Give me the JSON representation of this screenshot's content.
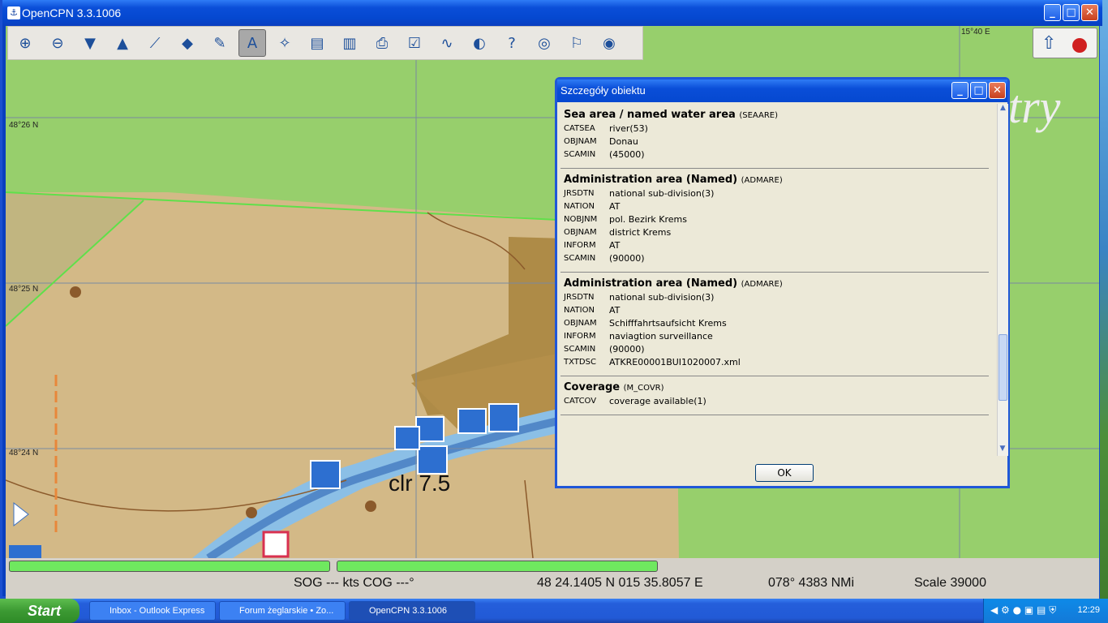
{
  "window": {
    "title": "OpenCPN 3.3.1006"
  },
  "chart": {
    "lat_labels": [
      "48°26 N",
      "48°25 N",
      "48°24 N"
    ],
    "lon_label": "15°40 E",
    "map_text": "clr 7.5",
    "overlay_text": "try"
  },
  "status": {
    "sog": "SOG --- kts COG ---°",
    "position": "48 24.1405 N   015 35.8057 E",
    "bearing": "078°  4383 NMi",
    "scale": "Scale 39000"
  },
  "dialog": {
    "title": "Szczegóły obiektu",
    "ok_label": "OK",
    "sections": [
      {
        "title": "Sea area / named water area",
        "code": "(SEAARE)",
        "rows": [
          [
            "CATSEA",
            "river(53)"
          ],
          [
            "OBJNAM",
            "Donau"
          ],
          [
            "SCAMIN",
            "(45000)"
          ]
        ]
      },
      {
        "title": "Administration area (Named)",
        "code": "(ADMARE)",
        "rows": [
          [
            "JRSDTN",
            "national sub-division(3)"
          ],
          [
            "NATION",
            "AT"
          ],
          [
            "NOBJNM",
            "pol. Bezirk Krems"
          ],
          [
            "OBJNAM",
            "district Krems"
          ],
          [
            "INFORM",
            "AT"
          ],
          [
            "SCAMIN",
            "(90000)"
          ]
        ]
      },
      {
        "title": "Administration area (Named)",
        "code": "(ADMARE)",
        "rows": [
          [
            "JRSDTN",
            "national sub-division(3)"
          ],
          [
            "NATION",
            "AT"
          ],
          [
            "OBJNAM",
            "Schifffahrtsaufsicht Krems"
          ],
          [
            "INFORM",
            "naviagtion surveillance"
          ],
          [
            "SCAMIN",
            "(90000)"
          ],
          [
            "TXTDSC",
            "ATKRE00001BUI1020007.xml"
          ]
        ]
      },
      {
        "title": "Coverage",
        "code": "(M_COVR)",
        "rows": [
          [
            "CATCOV",
            "coverage available(1)"
          ]
        ]
      }
    ]
  },
  "taskbar": {
    "start": "Start",
    "tasks": [
      "Inbox - Outlook Express",
      "Forum żeglarskie • Zo...",
      "OpenCPN 3.3.1006"
    ],
    "clock": "12:29"
  }
}
